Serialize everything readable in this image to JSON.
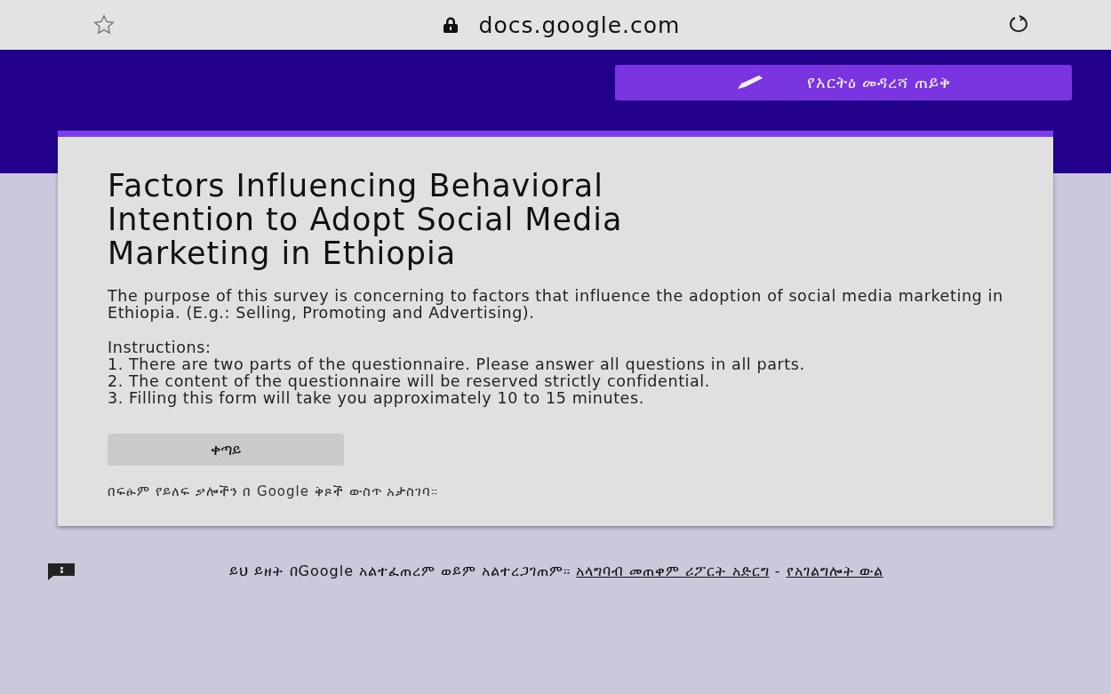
{
  "browser": {
    "url": "docs.google.com"
  },
  "request_edit_button": {
    "label": "የአርትዕ መዳረሻ ጠይቅ"
  },
  "form": {
    "title": "Factors Influencing Behavioral Intention to Adopt Social Media Marketing in Ethiopia",
    "description": [
      "The purpose of this survey is concerning to factors that influence the adoption of social media marketing in Ethiopia. (E.g.: Selling, Promoting and Advertising).",
      "Instructions:\n1. There are two parts of the questionnaire. Please answer all questions in all parts.\n2. The content of the questionnaire will be reserved strictly confidential.\n3. Filling this form will take you approximately 10 to 15 minutes."
    ],
    "next_button": {
      "label": "ቀጣይ"
    },
    "password_warning": "በፍፁም የይለፍ ቃሎችን በ Google ቅጾች ውስጥ አታስገባ።"
  },
  "footer": {
    "disclaimer": "ይህ ይዘት በGoogle አልተፈጠረም ወይም አልተረጋገጠም።",
    "links": [
      {
        "label": "አላግባብ መጠቀም ሪፖርት አድርግ"
      },
      {
        "label": "የአገልግሎት ውል"
      }
    ],
    "separator": "-"
  }
}
